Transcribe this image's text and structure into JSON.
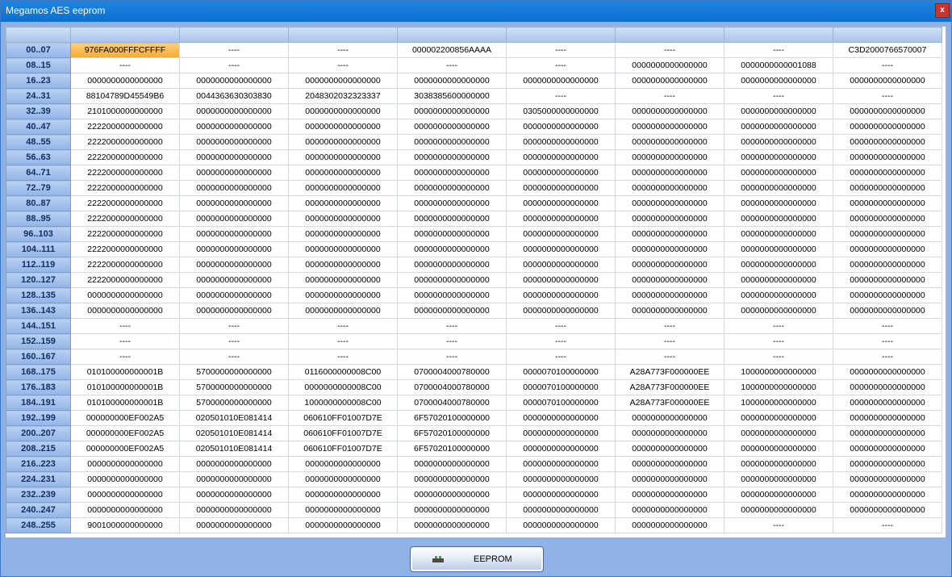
{
  "window": {
    "title": "Megamos AES eeprom",
    "close_label": "x"
  },
  "grid": {
    "columns": [
      "",
      "",
      "",
      "",
      "",
      "",
      "",
      ""
    ],
    "rows": [
      {
        "label": "00..07",
        "cells": [
          "976FA000FFFCFFFF",
          "----",
          "----",
          "000002200856AAAA",
          "----",
          "----",
          "----",
          "C3D2000766570007"
        ]
      },
      {
        "label": "08..15",
        "cells": [
          "----",
          "----",
          "----",
          "----",
          "----",
          "0000000000000000",
          "0000000000001088",
          "----"
        ]
      },
      {
        "label": "16..23",
        "cells": [
          "0000000000000000",
          "0000000000000000",
          "0000000000000000",
          "0000000000000000",
          "0000000000000000",
          "0000000000000000",
          "0000000000000000",
          "0000000000000000"
        ]
      },
      {
        "label": "24..31",
        "cells": [
          "88104789D45549B6",
          "0044363630303830",
          "2048302032323337",
          "3038385600000000",
          "----",
          "----",
          "----",
          "----"
        ]
      },
      {
        "label": "32..39",
        "cells": [
          "2101000000000000",
          "0000000000000000",
          "0000000000000000",
          "0000000000000000",
          "0305000000000000",
          "0000000000000000",
          "0000000000000000",
          "0000000000000000"
        ]
      },
      {
        "label": "40..47",
        "cells": [
          "2222000000000000",
          "0000000000000000",
          "0000000000000000",
          "0000000000000000",
          "0000000000000000",
          "0000000000000000",
          "0000000000000000",
          "0000000000000000"
        ]
      },
      {
        "label": "48..55",
        "cells": [
          "2222000000000000",
          "0000000000000000",
          "0000000000000000",
          "0000000000000000",
          "0000000000000000",
          "0000000000000000",
          "0000000000000000",
          "0000000000000000"
        ]
      },
      {
        "label": "56..63",
        "cells": [
          "2222000000000000",
          "0000000000000000",
          "0000000000000000",
          "0000000000000000",
          "0000000000000000",
          "0000000000000000",
          "0000000000000000",
          "0000000000000000"
        ]
      },
      {
        "label": "64..71",
        "cells": [
          "2222000000000000",
          "0000000000000000",
          "0000000000000000",
          "0000000000000000",
          "0000000000000000",
          "0000000000000000",
          "0000000000000000",
          "0000000000000000"
        ]
      },
      {
        "label": "72..79",
        "cells": [
          "2222000000000000",
          "0000000000000000",
          "0000000000000000",
          "0000000000000000",
          "0000000000000000",
          "0000000000000000",
          "0000000000000000",
          "0000000000000000"
        ]
      },
      {
        "label": "80..87",
        "cells": [
          "2222000000000000",
          "0000000000000000",
          "0000000000000000",
          "0000000000000000",
          "0000000000000000",
          "0000000000000000",
          "0000000000000000",
          "0000000000000000"
        ]
      },
      {
        "label": "88..95",
        "cells": [
          "2222000000000000",
          "0000000000000000",
          "0000000000000000",
          "0000000000000000",
          "0000000000000000",
          "0000000000000000",
          "0000000000000000",
          "0000000000000000"
        ]
      },
      {
        "label": "96..103",
        "cells": [
          "2222000000000000",
          "0000000000000000",
          "0000000000000000",
          "0000000000000000",
          "0000000000000000",
          "0000000000000000",
          "0000000000000000",
          "0000000000000000"
        ]
      },
      {
        "label": "104..111",
        "cells": [
          "2222000000000000",
          "0000000000000000",
          "0000000000000000",
          "0000000000000000",
          "0000000000000000",
          "0000000000000000",
          "0000000000000000",
          "0000000000000000"
        ]
      },
      {
        "label": "112..119",
        "cells": [
          "2222000000000000",
          "0000000000000000",
          "0000000000000000",
          "0000000000000000",
          "0000000000000000",
          "0000000000000000",
          "0000000000000000",
          "0000000000000000"
        ]
      },
      {
        "label": "120..127",
        "cells": [
          "2222000000000000",
          "0000000000000000",
          "0000000000000000",
          "0000000000000000",
          "0000000000000000",
          "0000000000000000",
          "0000000000000000",
          "0000000000000000"
        ]
      },
      {
        "label": "128..135",
        "cells": [
          "0000000000000000",
          "0000000000000000",
          "0000000000000000",
          "0000000000000000",
          "0000000000000000",
          "0000000000000000",
          "0000000000000000",
          "0000000000000000"
        ]
      },
      {
        "label": "136..143",
        "cells": [
          "0000000000000000",
          "0000000000000000",
          "0000000000000000",
          "0000000000000000",
          "0000000000000000",
          "0000000000000000",
          "0000000000000000",
          "0000000000000000"
        ]
      },
      {
        "label": "144..151",
        "cells": [
          "----",
          "----",
          "----",
          "----",
          "----",
          "----",
          "----",
          "----"
        ]
      },
      {
        "label": "152..159",
        "cells": [
          "----",
          "----",
          "----",
          "----",
          "----",
          "----",
          "----",
          "----"
        ]
      },
      {
        "label": "160..167",
        "cells": [
          "----",
          "----",
          "----",
          "----",
          "----",
          "----",
          "----",
          "----"
        ]
      },
      {
        "label": "168..175",
        "cells": [
          "010100000000001B",
          "5700000000000000",
          "0116000000008C00",
          "0700004000780000",
          "0000070100000000",
          "A28A773F000000EE",
          "1000000000000000",
          "0000000000000000"
        ]
      },
      {
        "label": "176..183",
        "cells": [
          "010100000000001B",
          "5700000000000000",
          "0000000000008C00",
          "0700004000780000",
          "0000070100000000",
          "A28A773F000000EE",
          "1000000000000000",
          "0000000000000000"
        ]
      },
      {
        "label": "184..191",
        "cells": [
          "010100000000001B",
          "5700000000000000",
          "1000000000008C00",
          "0700004000780000",
          "0000070100000000",
          "A28A773F000000EE",
          "1000000000000000",
          "0000000000000000"
        ]
      },
      {
        "label": "192..199",
        "cells": [
          "000000000EF002A5",
          "020501010E081414",
          "060610FF01007D7E",
          "6F57020100000000",
          "0000000000000000",
          "0000000000000000",
          "0000000000000000",
          "0000000000000000"
        ]
      },
      {
        "label": "200..207",
        "cells": [
          "000000000EF002A5",
          "020501010E081414",
          "060610FF01007D7E",
          "6F57020100000000",
          "0000000000000000",
          "0000000000000000",
          "0000000000000000",
          "0000000000000000"
        ]
      },
      {
        "label": "208..215",
        "cells": [
          "000000000EF002A5",
          "020501010E081414",
          "060610FF01007D7E",
          "6F57020100000000",
          "0000000000000000",
          "0000000000000000",
          "0000000000000000",
          "0000000000000000"
        ]
      },
      {
        "label": "216..223",
        "cells": [
          "0000000000000000",
          "0000000000000000",
          "0000000000000000",
          "0000000000000000",
          "0000000000000000",
          "0000000000000000",
          "0000000000000000",
          "0000000000000000"
        ]
      },
      {
        "label": "224..231",
        "cells": [
          "0000000000000000",
          "0000000000000000",
          "0000000000000000",
          "0000000000000000",
          "0000000000000000",
          "0000000000000000",
          "0000000000000000",
          "0000000000000000"
        ]
      },
      {
        "label": "232..239",
        "cells": [
          "0000000000000000",
          "0000000000000000",
          "0000000000000000",
          "0000000000000000",
          "0000000000000000",
          "0000000000000000",
          "0000000000000000",
          "0000000000000000"
        ]
      },
      {
        "label": "240..247",
        "cells": [
          "0000000000000000",
          "0000000000000000",
          "0000000000000000",
          "0000000000000000",
          "0000000000000000",
          "0000000000000000",
          "0000000000000000",
          "0000000000000000"
        ]
      },
      {
        "label": "248..255",
        "cells": [
          "9001000000000000",
          "0000000000000000",
          "0000000000000000",
          "0000000000000000",
          "0000000000000000",
          "0000000000000000",
          "----",
          "----"
        ]
      }
    ],
    "selected": {
      "row": 0,
      "col": 0
    }
  },
  "footer": {
    "button_label": "EEPROM",
    "button_icon": "chip-icon"
  },
  "colors": {
    "selected_cell": "#f6a932",
    "title_bar": "#0a6fcf",
    "row_header": "#93b5e6"
  }
}
